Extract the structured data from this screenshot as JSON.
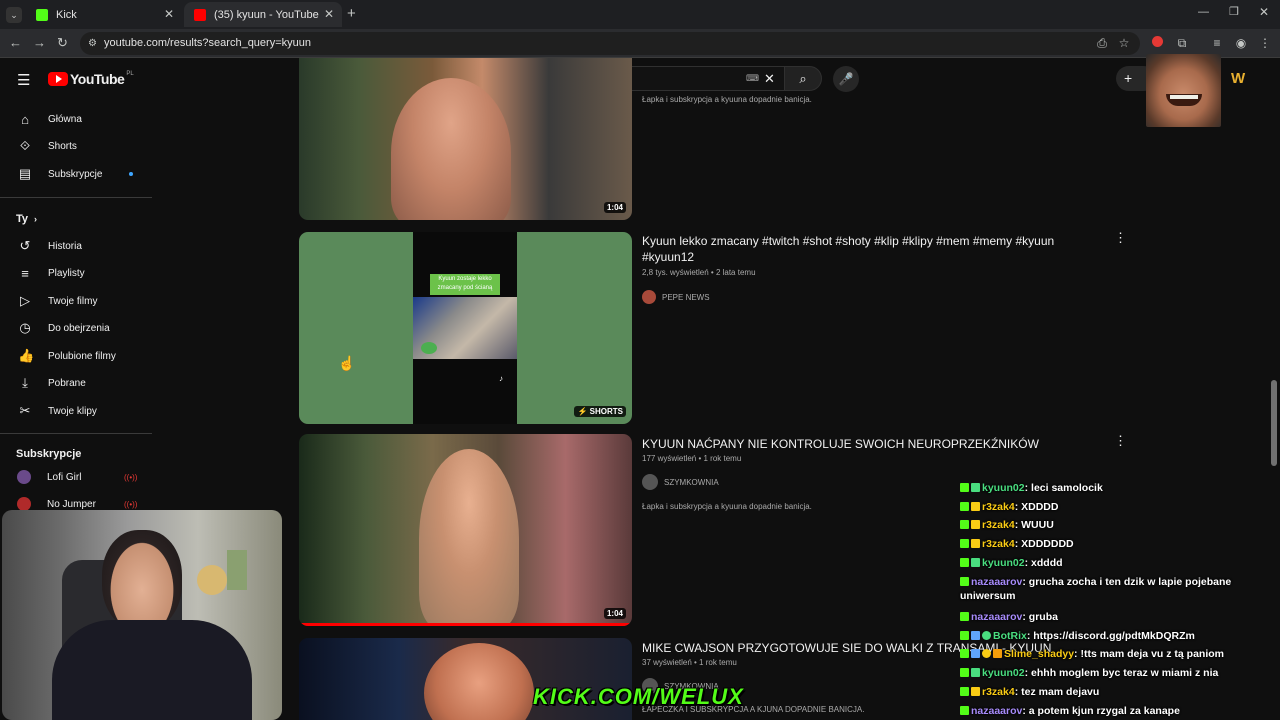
{
  "browser": {
    "tabs": [
      {
        "label": "Kick"
      },
      {
        "label": "(35) kyuun - YouTube"
      }
    ],
    "url": "youtube.com/results?search_query=kyuun",
    "new_tab": "+"
  },
  "youtube": {
    "logo_text": "YouTube",
    "region": "PL",
    "search_value": "kyuun",
    "sidebar": {
      "main": [
        "Główna",
        "Shorts",
        "Subskrypcje"
      ],
      "you_header": "Ty",
      "you_items": [
        "Historia",
        "Playlisty",
        "Twoje filmy",
        "Do obejrzenia",
        "Polubione filmy",
        "Pobrane",
        "Twoje klipy"
      ],
      "subs_header": "Subskrypcje",
      "subs": [
        "Lofi Girl",
        "No Jumper"
      ]
    },
    "videos": [
      {
        "desc": "Łapka i subskrypcja a kyuuna dopadnie banicja.",
        "duration": "1:04"
      },
      {
        "title": "Kyuun lekko zmacany #twitch #shot #shoty #klip #klipy #mem #memy #kyuun #kyuun12",
        "meta": "2,8 tys. wyświetleń • 2 lata temu",
        "channel": "PEPE NEWS",
        "badge": "SHORTS",
        "overlay_text": "Kyuun zostaje lekko zmacany pod ścianą"
      },
      {
        "title": "KYUUN NAĆPANY NIE KONTROLUJE SWOICH NEUROPRZEKŹNIKÓW",
        "meta": "177 wyświetleń • 1 rok temu",
        "channel": "SZYMKOWNIA",
        "desc": "Łapka i subskrypcja a kyuuna dopadnie banicja.",
        "duration": "1:04"
      },
      {
        "title": "MIKE CWAJSON PRZYGOTOWUJE SIE DO WALKI Z TRANSAMI - KYUUN",
        "meta": "37 wyświetleń • 1 rok temu",
        "channel": "SZYMKOWNIA",
        "desc": "ŁAPECZKA I SUBSKRYPCJA A KJUNA DOPADNIE BANICJA."
      }
    ]
  },
  "overlay": {
    "kick_url": "KICK.COM/WELUX",
    "chat": [
      {
        "user": "kyuun02",
        "text": ": leci samolocik"
      },
      {
        "user": "r3zak4",
        "text": ": XDDDD"
      },
      {
        "user": "r3zak4",
        "text": ": WUUU"
      },
      {
        "user": "r3zak4",
        "text": ": XDDDDDD"
      },
      {
        "user": "kyuun02",
        "text": ": xdddd"
      },
      {
        "user": "nazaaarov",
        "text": ": grucha zocha i ten dzik w lapie pojebane uniwersum"
      },
      {
        "user": "nazaaarov",
        "text": ": gruba"
      },
      {
        "user": "BotRix",
        "text": ": https://discord.gg/pdtMkDQRZm"
      },
      {
        "user": "Slime_shadyy",
        "text": ": !tts mam deja vu z tą paniom"
      },
      {
        "user": "kyuun02",
        "text": ": ehhh moglem byc teraz w miami z nia"
      },
      {
        "user": "r3zak4",
        "text": ": tez mam dejavu"
      },
      {
        "user": "nazaaarov",
        "text": ": a potem kjun rzygal za kanape"
      }
    ]
  },
  "colors": {
    "youtube_red": "#ff0000",
    "kick_green": "#53fc18",
    "bg": "#0f0f0f"
  }
}
